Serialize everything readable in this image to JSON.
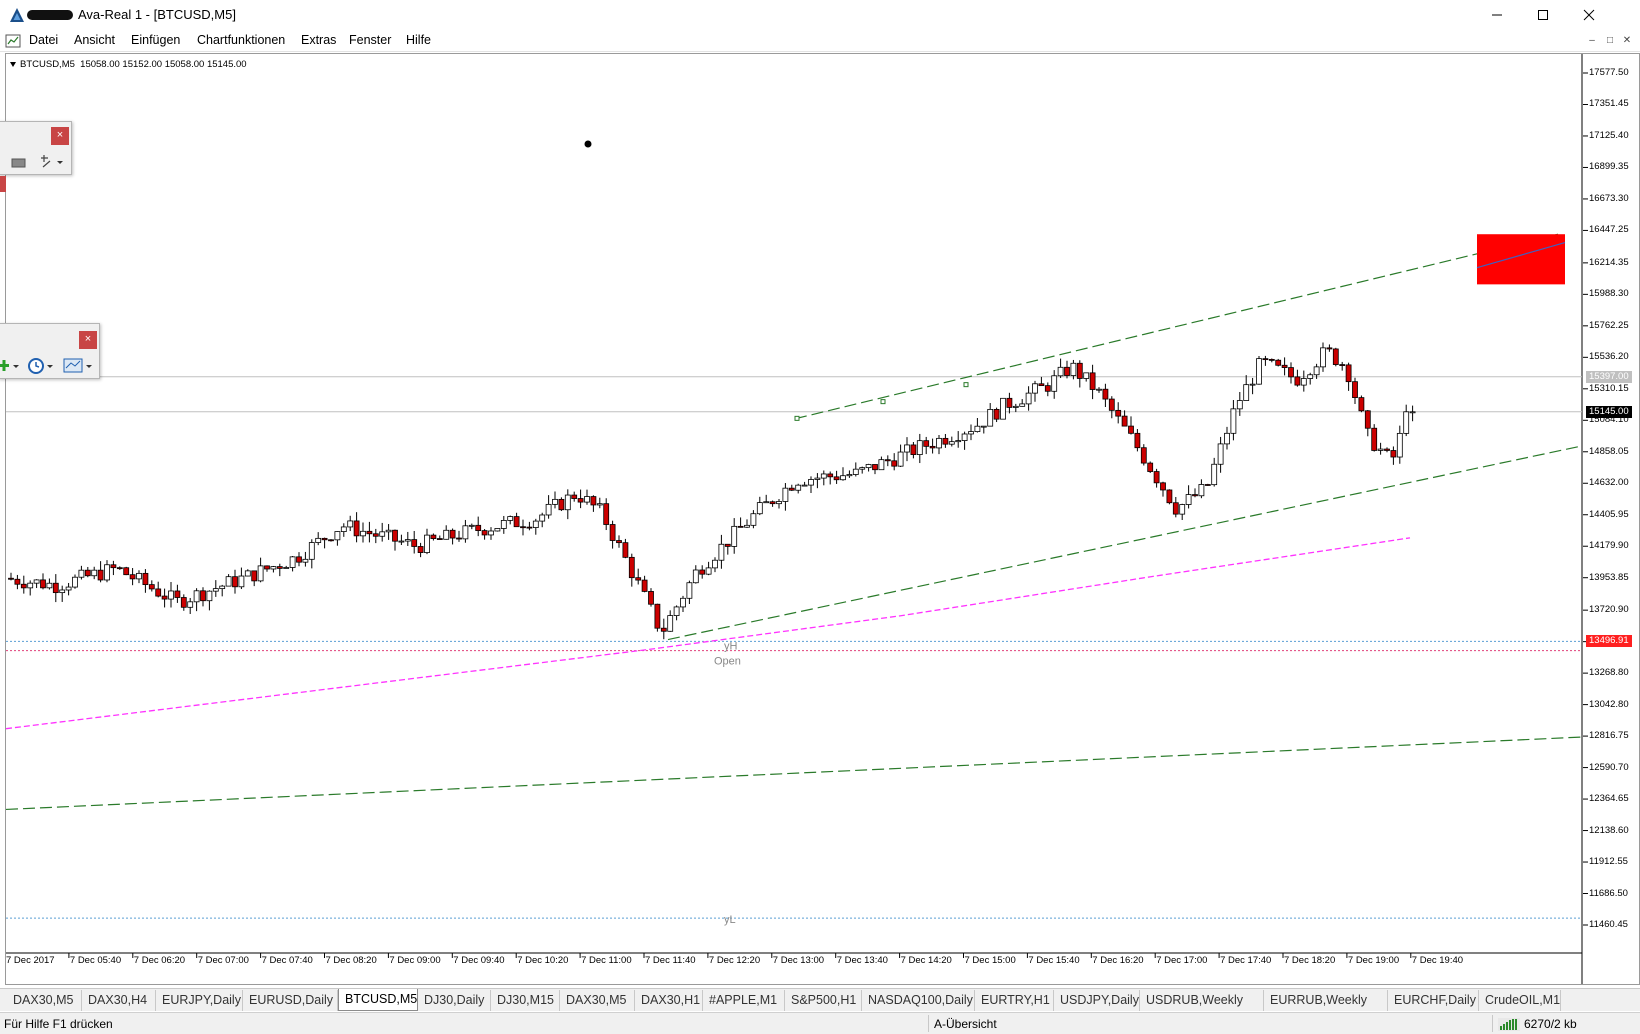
{
  "window": {
    "title": "Ava-Real 1 - [BTCUSD,M5]",
    "controls": {
      "minimize": "–",
      "maximize": "□",
      "close": "✕"
    }
  },
  "menu": {
    "items": [
      "Datei",
      "Ansicht",
      "Einfügen",
      "Chartfunktionen",
      "Extras",
      "Fenster",
      "Hilfe"
    ]
  },
  "chart_data": {
    "type": "candlestick",
    "symbol_header": "BTCUSD,M5  15058.00 15152.00 15058.00 15145.00",
    "y_ticks": [
      "17577.50",
      "17351.45",
      "17125.40",
      "16899.35",
      "16673.30",
      "16447.25",
      "16214.35",
      "15988.30",
      "15762.25",
      "15536.20",
      "15310.15",
      "15084.10",
      "14858.05",
      "14632.00",
      "14405.95",
      "14179.90",
      "13953.85",
      "13720.90",
      "13494.85",
      "13268.80",
      "13042.80",
      "12816.75",
      "12590.70",
      "12364.65",
      "12138.60",
      "11912.55",
      "11686.50",
      "11460.45"
    ],
    "ylim": [
      11460.45,
      17577.5
    ],
    "x_ticks": [
      "7 Dec 2017",
      "7 Dec 05:40",
      "7 Dec 06:20",
      "7 Dec 07:00",
      "7 Dec 07:40",
      "7 Dec 08:20",
      "7 Dec 09:00",
      "7 Dec 09:40",
      "7 Dec 10:20",
      "7 Dec 11:00",
      "7 Dec 11:40",
      "7 Dec 12:20",
      "7 Dec 13:00",
      "7 Dec 13:40",
      "7 Dec 14:20",
      "7 Dec 15:00",
      "7 Dec 15:40",
      "7 Dec 16:20",
      "7 Dec 17:00",
      "7 Dec 17:40",
      "7 Dec 18:20",
      "7 Dec 19:00",
      "7 Dec 19:40"
    ],
    "price_labels": [
      {
        "value": "15397.00",
        "bg": "#c0c0c0",
        "fg": "#ffffff"
      },
      {
        "value": "15145.00",
        "bg": "#000000",
        "fg": "#ffffff"
      },
      {
        "value": "13496.91",
        "bg": "#ff2020",
        "fg": "#ffffff"
      }
    ],
    "line_labels": [
      "yH",
      "Open",
      "yL"
    ],
    "colors": {
      "bull": "#ffffff",
      "bear": "#cc0000",
      "wick": "#000000",
      "channel": "#2a7a2a",
      "ma": "#ff33ff",
      "hline_blue": "#5a9fd4",
      "hline_red": "#e0407a",
      "marker": "#ff0000"
    }
  },
  "toolbars": {
    "top_close": "×",
    "bottom_close": "×"
  },
  "tabs": {
    "items": [
      "DAX30,M5",
      "DAX30,H4",
      "EURJPY,Daily",
      "EURUSD,Daily",
      "BTCUSD,M5",
      "DJ30,Daily",
      "DJ30,M15",
      "DAX30,M5",
      "DAX30,H1",
      "#APPLE,M1",
      "S&P500,H1",
      "NASDAQ100,Daily",
      "EURTRY,H1",
      "USDJPY,Daily",
      "USDRUB,Weekly",
      "EURRUB,Weekly",
      "EURCHF,Daily",
      "CrudeOIL,M1"
    ],
    "active_index": 4
  },
  "status": {
    "help": "Für Hilfe F1 drücken",
    "profile": "A-Übersicht",
    "traffic": "6270/2 kb"
  }
}
